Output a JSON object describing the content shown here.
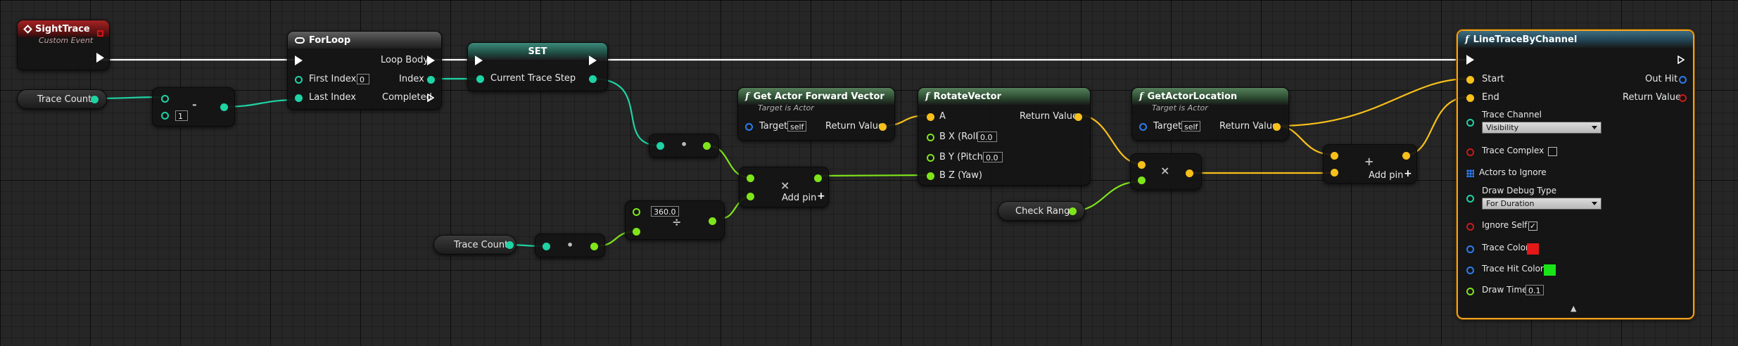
{
  "nodes": {
    "sight_trace": {
      "title": "SightTrace",
      "subtitle": "Custom Event"
    },
    "trace_count_1": {
      "label": "Trace Count"
    },
    "minus": {
      "value": "1",
      "symbol": "-"
    },
    "for_loop": {
      "title": "ForLoop",
      "loop_body": "Loop Body",
      "first_index": "First Index",
      "first_index_value": "0",
      "index": "Index",
      "last_index": "Last Index",
      "completed": "Completed"
    },
    "set": {
      "title": "SET",
      "var": "Current Trace Step"
    },
    "mult_small": {
      "symbol": "•"
    },
    "mult_add": {
      "symbol": "×",
      "add_pin": "Add pin",
      "add_icon": "+"
    },
    "divide": {
      "value": "360.0",
      "symbol": "÷"
    },
    "trace_count_2": {
      "label": "Trace Count"
    },
    "mult_tc": {
      "symbol": "•"
    },
    "forward": {
      "title": "Get Actor Forward Vector",
      "subtitle": "Target is Actor",
      "target": "Target",
      "target_value": "self",
      "return": "Return Value"
    },
    "rotate": {
      "title": "RotateVector",
      "a": "A",
      "return": "Return Value",
      "bx": "B X (Roll)",
      "bx_value": "0.0",
      "by": "B Y (Pitch)",
      "by_value": "0.0",
      "bz": "B Z (Yaw)"
    },
    "location": {
      "title": "GetActorLocation",
      "subtitle": "Target is Actor",
      "target": "Target",
      "target_value": "self",
      "return": "Return Value"
    },
    "check_range": {
      "label": "Check Range"
    },
    "mult_vec": {
      "symbol": "×"
    },
    "add": {
      "symbol": "+",
      "add_pin": "Add pin",
      "add_icon": "+"
    },
    "line_trace": {
      "title": "LineTraceByChannel",
      "start": "Start",
      "out_hit": "Out Hit",
      "end": "End",
      "return": "Return Value",
      "trace_channel": "Trace Channel",
      "trace_channel_value": "Visibility",
      "trace_complex": "Trace Complex",
      "actors_to_ignore": "Actors to Ignore",
      "draw_debug_type": "Draw Debug Type",
      "draw_debug_type_value": "For Duration",
      "ignore_self": "Ignore Self",
      "ignore_self_check": "✓",
      "trace_color": "Trace Color",
      "trace_color_value": "#e41818",
      "trace_hit_color": "Trace Hit Color",
      "trace_hit_color_value": "#18e418",
      "draw_time": "Draw Time",
      "draw_time_value": "0.1",
      "collapse_icon": "▲"
    }
  }
}
